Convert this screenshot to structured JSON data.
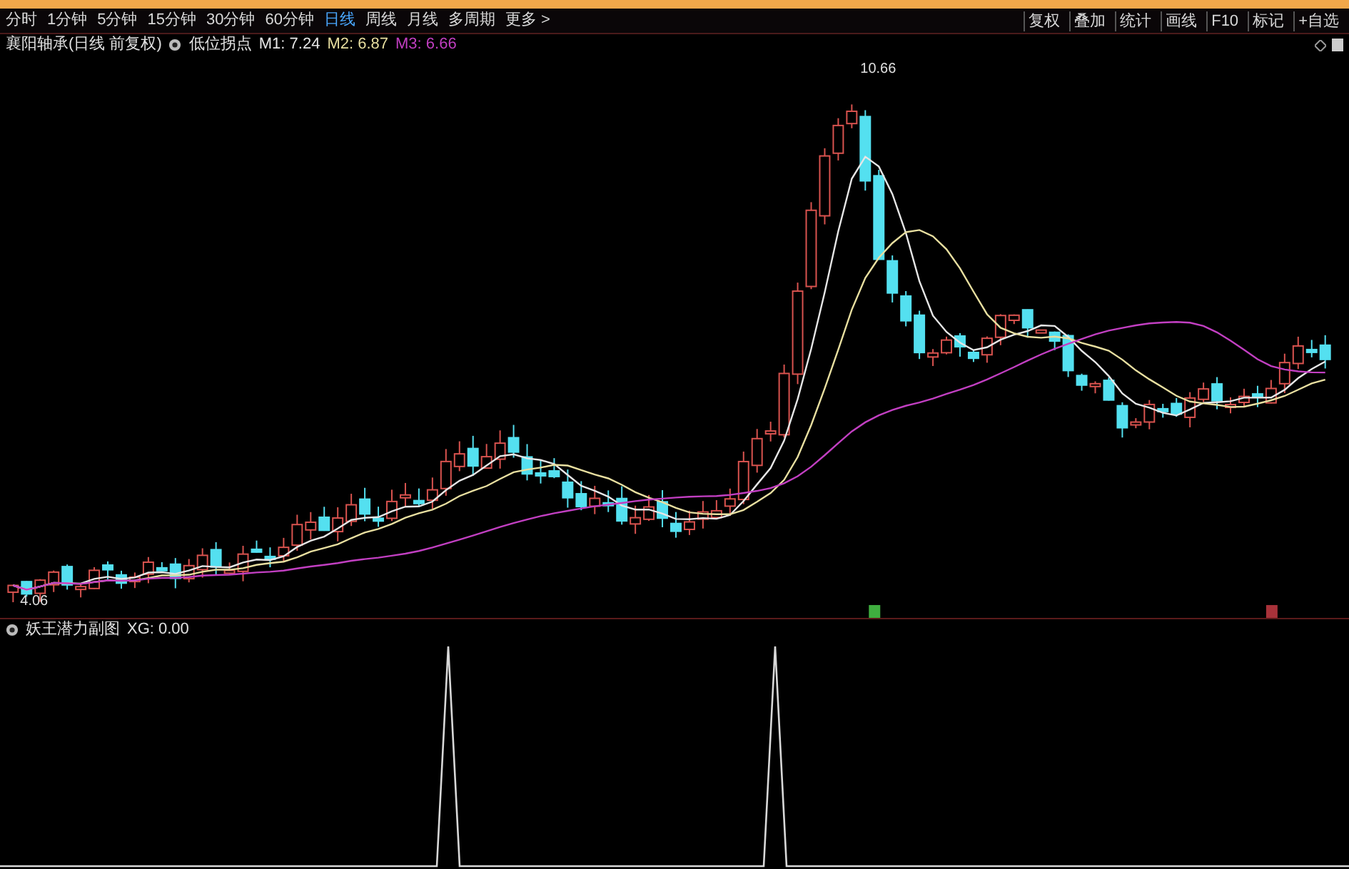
{
  "toolbar": {
    "periods": [
      {
        "label": "分时",
        "selected": false
      },
      {
        "label": "1分钟",
        "selected": false
      },
      {
        "label": "5分钟",
        "selected": false
      },
      {
        "label": "15分钟",
        "selected": false
      },
      {
        "label": "30分钟",
        "selected": false
      },
      {
        "label": "60分钟",
        "selected": false
      },
      {
        "label": "日线",
        "selected": true
      },
      {
        "label": "周线",
        "selected": false
      },
      {
        "label": "月线",
        "selected": false
      },
      {
        "label": "多周期",
        "selected": false
      },
      {
        "label": "更多 >",
        "selected": false
      }
    ],
    "actions": [
      "复权",
      "叠加",
      "统计",
      "画线",
      "F10",
      "标记",
      "+自选"
    ]
  },
  "main_legend": {
    "title": "襄阳轴承(日线 前复权)",
    "indicator": "低位拐点",
    "values": [
      {
        "text": "M1: 7.24",
        "color": "#e6e6e6"
      },
      {
        "text": "M2: 6.87",
        "color": "#e8dfa0"
      },
      {
        "text": "M3: 6.66",
        "color": "#c23fc2"
      }
    ]
  },
  "price_chart": {
    "high_label": "10.66",
    "low_label": "4.06"
  },
  "sub_legend": {
    "title": "妖王潜力副图",
    "value": "XG: 0.00"
  }
}
